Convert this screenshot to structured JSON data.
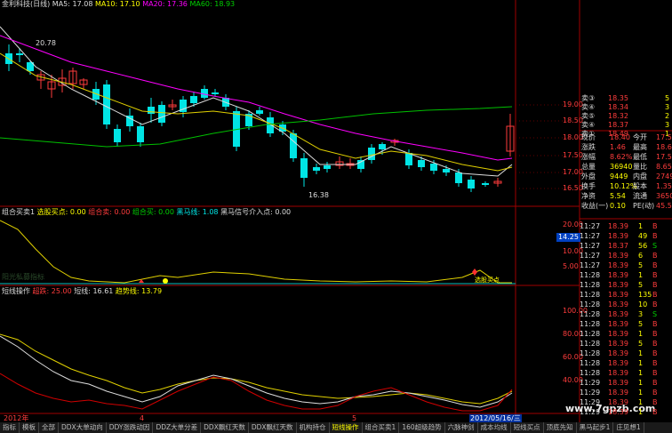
{
  "top_bar": {
    "stock": "金利科技(日线)",
    "ma5": "MA5: 17.08",
    "ma10": "MA10: 17.10",
    "ma20": "MA20: 17.36",
    "ma60": "MA60: 18.93"
  },
  "price_axis": [
    "19.00",
    "18.50",
    "18.00",
    "17.50",
    "17.00",
    "16.50"
  ],
  "annotations": {
    "high": "20.78",
    "low": "16.38"
  },
  "panel2": {
    "name": "组合买卖1",
    "buy": "选股买点: 0.00",
    "sell": "组合卖: 0.00",
    "buy2": "组合买: 0.00",
    "heima": "黑马线: 1.08",
    "signal": "黑马信号介入点: 0.00",
    "axis": [
      "20.00",
      "15.00",
      "10.00",
      "5.00"
    ],
    "highlight": "14.25",
    "watermark": "阳光私募指标",
    "mark": "选股买点"
  },
  "panel3": {
    "name": "短线操作",
    "l1": "超跌: 25.00",
    "l2": "短线: 16.61",
    "l3": "趋势线: 13.79",
    "axis": [
      "100.00",
      "80.00",
      "60.00",
      "40.00"
    ]
  },
  "dates": {
    "d1": "2012年",
    "d2": "4",
    "d3": "5",
    "d4": "2012/05/16/三"
  },
  "tabs": [
    "指标",
    "模板",
    "全部",
    "DDX大单动向",
    "DDY涨跌动因",
    "DDZ大单分差",
    "DDX飘红天数",
    "DDX飘红天数",
    "机构持仓",
    "短线操作",
    "组合买卖1",
    "160超级趋势",
    "六脉神剑",
    "成本均线",
    "短线买点",
    "顶底先知",
    "黑马起步1",
    "庄见想1"
  ],
  "quote": {
    "rows": [
      {
        "l": "卖③",
        "v": "18.35",
        "v2": "",
        "r": "5"
      },
      {
        "l": "卖④",
        "v": "18.34",
        "v2": "",
        "r": "3"
      },
      {
        "l": "卖⑤",
        "v": "18.32",
        "v2": "",
        "r": "2"
      },
      {
        "l": "卖④",
        "v": "18.37",
        "v2": "",
        "r": "3"
      },
      {
        "l": "卖①",
        "v": "18.49",
        "v2": "",
        "r": "1"
      }
    ],
    "stats": [
      {
        "a": "现价",
        "b": "18.40",
        "c": "今开",
        "d": "17.54"
      },
      {
        "a": "涨跌",
        "b": "1.46",
        "c": "最高",
        "d": "18.66"
      },
      {
        "a": "涨幅",
        "b": "8.62%",
        "c": "最低",
        "d": "17.54"
      },
      {
        "a": "总量",
        "b": "36940",
        "c": "量比",
        "d": "8.65"
      },
      {
        "a": "外盘",
        "b": "9449",
        "c": "内盘",
        "d": "27491"
      },
      {
        "a": "换手",
        "b": "10.12%",
        "c": "股本",
        "d": "1.35亿"
      },
      {
        "a": "净资",
        "b": "5.54",
        "c": "流通",
        "d": "3650万"
      },
      {
        "a": "收益(一)",
        "b": "0.10",
        "c": "PE(动)",
        "d": "45.5"
      }
    ],
    "ticks": [
      {
        "t": "11:27",
        "p": "18.39",
        "v": "1",
        "s": "B"
      },
      {
        "t": "11:27",
        "p": "18.39",
        "v": "49",
        "s": "B"
      },
      {
        "t": "11:27",
        "p": "18.37",
        "v": "56",
        "s": "S"
      },
      {
        "t": "11:27",
        "p": "18.39",
        "v": "6",
        "s": "B"
      },
      {
        "t": "11:27",
        "p": "18.39",
        "v": "5",
        "s": "B"
      },
      {
        "t": "11:28",
        "p": "18.39",
        "v": "1",
        "s": "B"
      },
      {
        "t": "11:28",
        "p": "18.39",
        "v": "5",
        "s": "B"
      },
      {
        "t": "11:28",
        "p": "18.39",
        "v": "135",
        "s": "B"
      },
      {
        "t": "11:28",
        "p": "18.39",
        "v": "10",
        "s": "B"
      },
      {
        "t": "11:28",
        "p": "18.39",
        "v": "3",
        "s": "S"
      },
      {
        "t": "11:28",
        "p": "18.39",
        "v": "5",
        "s": "B"
      },
      {
        "t": "11:28",
        "p": "18.39",
        "v": "1",
        "s": "B"
      },
      {
        "t": "11:28",
        "p": "18.39",
        "v": "5",
        "s": "B"
      },
      {
        "t": "11:28",
        "p": "18.39",
        "v": "1",
        "s": "B"
      },
      {
        "t": "11:28",
        "p": "18.39",
        "v": "1",
        "s": "B"
      },
      {
        "t": "11:28",
        "p": "18.39",
        "v": "1",
        "s": "B"
      },
      {
        "t": "11:29",
        "p": "18.39",
        "v": "1",
        "s": "B"
      },
      {
        "t": "11:29",
        "p": "18.39",
        "v": "1",
        "s": "B"
      },
      {
        "t": "11:29",
        "p": "18.39",
        "v": "1",
        "s": "B"
      },
      {
        "t": "11:29",
        "p": "18.39",
        "v": "1",
        "s": "B"
      }
    ]
  },
  "watermark": "www.7gpzb.com"
}
